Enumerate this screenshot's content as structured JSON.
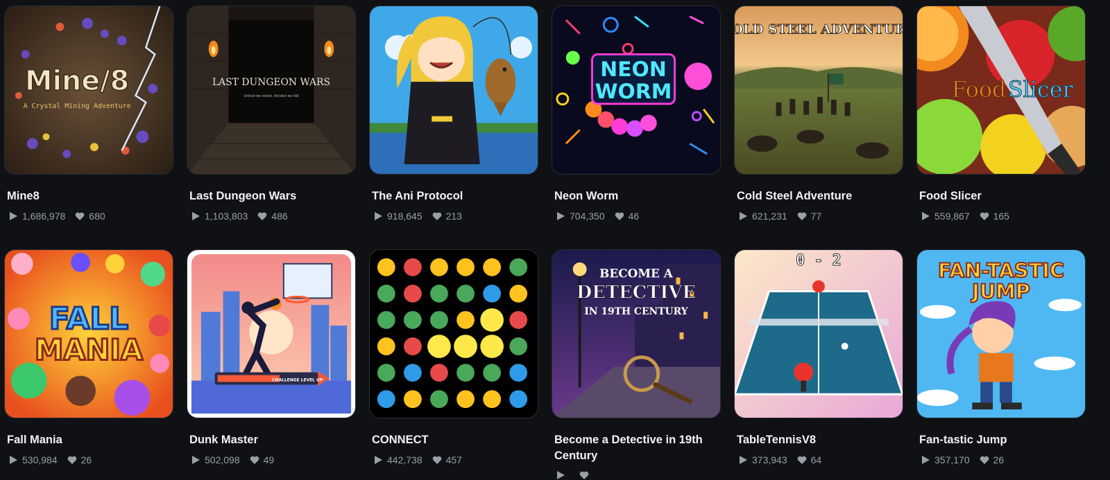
{
  "games": [
    {
      "title": "Mine8",
      "plays": "1,686,978",
      "likes": "680",
      "art_title": "Mine/8",
      "art_subtitle": "A Crystal Mining Adventure"
    },
    {
      "title": "Last Dungeon Wars",
      "plays": "1,103,803",
      "likes": "486",
      "art_title": "LAST DUNGEON WARS",
      "art_subtitle": "United we stand, divided we fall"
    },
    {
      "title": "The Ani Protocol",
      "plays": "918,645",
      "likes": "213"
    },
    {
      "title": "Neon Worm",
      "plays": "704,350",
      "likes": "46",
      "art_title_1": "NEON",
      "art_title_2": "WORM"
    },
    {
      "title": "Cold Steel Adventure",
      "plays": "621,231",
      "likes": "77",
      "art_title": "COLD STEEL ADVENTURE"
    },
    {
      "title": "Food Slicer",
      "plays": "559,867",
      "likes": "165",
      "art_title_1": "Food",
      "art_title_2": "Slicer"
    },
    {
      "title": "Fall Mania",
      "plays": "530,984",
      "likes": "26",
      "art_title_1": "FALL",
      "art_title_2": "MANIA"
    },
    {
      "title": "Dunk Master",
      "plays": "502,098",
      "likes": "49",
      "art_title": "CHALLENGE LEVEL UP"
    },
    {
      "title": "CONNECT",
      "plays": "442,738",
      "likes": "457"
    },
    {
      "title": "Become a Detective in 19th Century",
      "plays": "",
      "likes": "",
      "art_line_1": "BECOME A",
      "art_line_2": "DETECTIVE",
      "art_line_3": "IN 19TH CENTURY"
    },
    {
      "title": "TableTennisV8",
      "plays": "373,943",
      "likes": "64",
      "art_score": "0 - 2"
    },
    {
      "title": "Fan-tastic Jump",
      "plays": "357,170",
      "likes": "26",
      "art_title_1": "FAN-TASTIC",
      "art_title_2": "JUMP"
    }
  ],
  "icons": {
    "plays": "play-icon",
    "likes": "heart-icon"
  },
  "colors": {
    "background": "#0f1114",
    "title": "#f2f3f5",
    "meta": "#9aa0a8"
  }
}
